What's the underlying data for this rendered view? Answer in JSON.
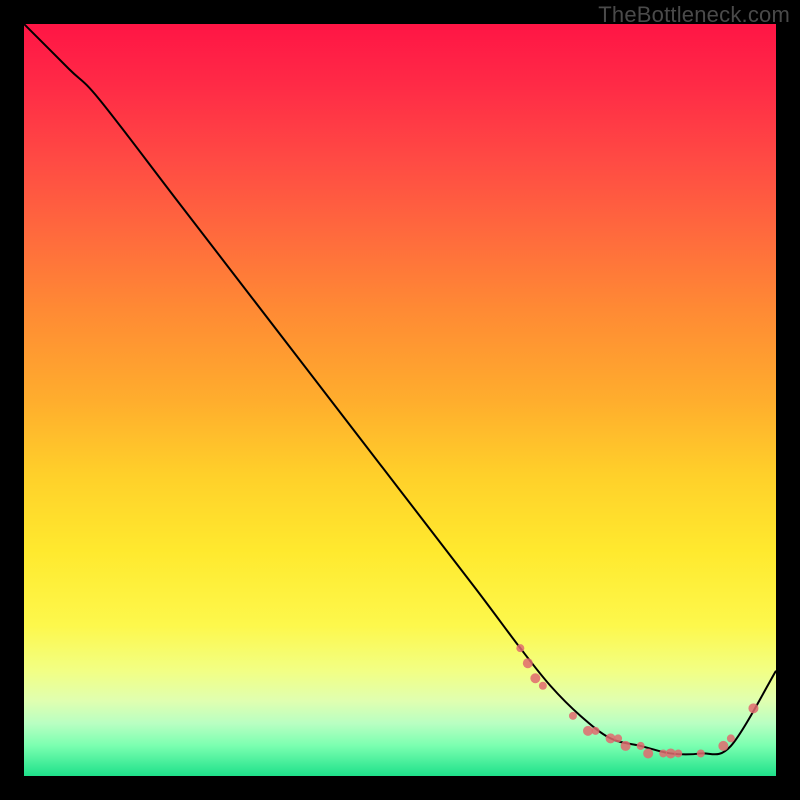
{
  "watermark": "TheBottleneck.com",
  "chart_data": {
    "type": "line",
    "title": "",
    "xlabel": "",
    "ylabel": "",
    "xlim": [
      0,
      100
    ],
    "ylim": [
      0,
      100
    ],
    "series": [
      {
        "name": "bottleneck-curve",
        "x": [
          0,
          6,
          10,
          20,
          30,
          40,
          50,
          60,
          66,
          70,
          74,
          78,
          82,
          86,
          90,
          94,
          100
        ],
        "y": [
          100,
          94,
          90,
          77,
          64,
          51,
          38,
          25,
          17,
          12,
          8,
          5,
          4,
          3,
          3,
          4,
          14
        ]
      }
    ],
    "markers": {
      "name": "highlight-points",
      "color": "#e06a6e",
      "points": [
        {
          "x": 66,
          "y": 17,
          "r": 4
        },
        {
          "x": 67,
          "y": 15,
          "r": 5
        },
        {
          "x": 68,
          "y": 13,
          "r": 5
        },
        {
          "x": 69,
          "y": 12,
          "r": 4
        },
        {
          "x": 73,
          "y": 8,
          "r": 4
        },
        {
          "x": 75,
          "y": 6,
          "r": 5
        },
        {
          "x": 76,
          "y": 6,
          "r": 4
        },
        {
          "x": 78,
          "y": 5,
          "r": 5
        },
        {
          "x": 79,
          "y": 5,
          "r": 4
        },
        {
          "x": 80,
          "y": 4,
          "r": 5
        },
        {
          "x": 82,
          "y": 4,
          "r": 4
        },
        {
          "x": 83,
          "y": 3,
          "r": 5
        },
        {
          "x": 85,
          "y": 3,
          "r": 4
        },
        {
          "x": 86,
          "y": 3,
          "r": 5
        },
        {
          "x": 87,
          "y": 3,
          "r": 4
        },
        {
          "x": 90,
          "y": 3,
          "r": 4
        },
        {
          "x": 93,
          "y": 4,
          "r": 5
        },
        {
          "x": 94,
          "y": 5,
          "r": 4
        },
        {
          "x": 97,
          "y": 9,
          "r": 5
        }
      ]
    }
  }
}
